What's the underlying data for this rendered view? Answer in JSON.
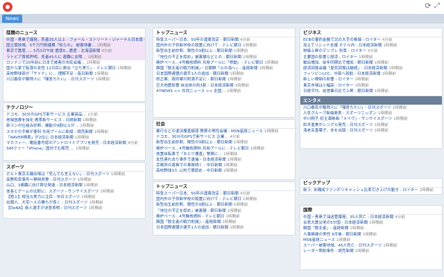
{
  "header": {
    "logo": "app-logo",
    "tab_label": "News",
    "icons": [
      "refresh-icon",
      "expand-icon"
    ]
  },
  "panels": [
    {
      "id": "p1",
      "title": "話題のニュース",
      "highlight": [
        0,
        1,
        2,
        3
      ],
      "items": [
        {
          "text": "中国・青島で爆発。死者35人以上 - フォール・ストリート・ジャーナル日本版",
          "time": "4分前"
        },
        {
          "text": "国立競技場、5千万円修繕費「知られ」 被害地審…",
          "time": "1時間前"
        },
        {
          "text": "東京で震度…。5月3日午前 震度6…震度 - 北海道新聞",
          "time": "4分前"
        },
        {
          "text": "ラトビア首相声明、死者45人に 避難に支障…",
          "time": "1時間前"
        },
        {
          "text": "ロンドンで20年前に日本で被害の市民会議…",
          "time": "1時間前"
        },
        {
          "text": "国から家で転落の女性 12日目に救出「立ち寄り」- テレビ朝日",
          "time": "1時間前"
        },
        {
          "text": "高校野球部が「サイド」に… 理解不足 - 毎日新聞",
          "time": "1時間前"
        },
        {
          "text": "川口春奈が駆除人に「嘆答ちたい」- 日刊スポーツ",
          "time": "1時間前"
        }
      ]
    },
    {
      "id": "p2",
      "title": "テクノロジー",
      "items": [
        {
          "text": "ドコモ、30分のGPSで新サービス 企業商品…",
          "time": "1分前"
        },
        {
          "text": "地域医療を強化 携帯新サービス - 日経新聞",
          "time": "1時間前"
        },
        {
          "text": "新ランの仕組み診断、機能の9割以上が…",
          "time": "1時間前"
        },
        {
          "text": "スマホの手帳が便利 共用プールに新設 - 読売新聞",
          "time": "1時間前"
        },
        {
          "text": "「NAVER検索」が2位に 日本経済新聞",
          "time": "1時間前"
        },
        {
          "text": "マカフィー、電話番号認のアンドロイドアプリを発売 - 日本経済新聞",
          "time": "4分前"
        },
        {
          "text": "SIMフリー「iPhone」国内でも販売 …",
          "time": "1時間前"
        }
      ]
    },
    {
      "id": "p3",
      "title": "スポーツ",
      "items": [
        {
          "text": "ボルト東京五輪出場は「死んでも言えない」- 日刊スポーツ",
          "time": "1時間前"
        },
        {
          "text": "高野和幸事件＝静岡県警 - 日刊スポーツ",
          "time": "1時間前"
        },
        {
          "text": "山口、3連覇に向け首位発進 - 日本経済新聞",
          "time": "1時間前"
        },
        {
          "text": "信長とゲームの比較に、スポーツ - サンケイスポーツ",
          "time": "1時間前"
        },
        {
          "text": "【陸上】相当な実力に注目 - 中日スポーツ",
          "time": "1時間前"
        },
        {
          "text": "出頭人、大宅一人の勝ちが良く - 日刊スポーツ",
          "time": "1時間前"
        },
        {
          "text": "【DeNA】新人選手が決意表明 - 日刊スポーツ",
          "time": "1時間前"
        }
      ]
    },
    {
      "id": "p4",
      "title": "トップニュース",
      "items": [
        {
          "text": "特急スーパー日本、50年の運賃改定 - 朝日新聞",
          "time": "4分前"
        },
        {
          "text": "国内外の子供新学校の設置に向けて - テレビ朝日",
          "time": "1時間前"
        },
        {
          "text": "新型出生前診断、陽性の9割以上 - 朝日新聞",
          "time": "1時間前"
        },
        {
          "text": "「地位の不正を認め」被害額などとの - 朝日新聞",
          "time": "1時間前"
        },
        {
          "text": "廃炉ペース…4号機核燃料 共用プールに「移動」- テレビ朝日",
          "time": "1時間前"
        },
        {
          "text": "韓国「脱北者の戦力削減」・北朝鮮「火の海へ」- 産経新聞",
          "time": "1時間前"
        },
        {
          "text": "日本国際連盟の選手1人の追加 - 朝日新聞",
          "time": "1時間前"
        },
        {
          "text": "修正案、政府案の財源不足に - 朝日新聞",
          "time": "1時間前"
        },
        {
          "text": "巨大地震影響 自治体の約3割 - 日本経済新聞",
          "time": "1時間前"
        },
        {
          "text": "47NEWS >> 共同ニュース >> 全国…",
          "time": "1時間前"
        }
      ]
    },
    {
      "id": "p5",
      "title": "社会",
      "items": [
        {
          "text": "暴行などの違法捜査疑惑 警察の男性会議 - MSN産経ニュース",
          "time": "1時間前"
        },
        {
          "text": "ドコモ、30分のGPSで新サービス 企業…",
          "time": "4分前"
        },
        {
          "text": "新型出生前診断、陽性の9割以上 - 朝日新聞",
          "time": "1時間前"
        },
        {
          "text": "廃炉ペース…4号機核燃料 共用プールに - テレビ朝日",
          "time": "1時間前"
        },
        {
          "text": "放置自転車で「おとり捜査」警察に…",
          "time": "1時間前"
        },
        {
          "text": "女性連れ去り事件で逮捕 - 日本経済新聞",
          "time": "1時間前"
        },
        {
          "text": "京都府の遊具での事故続く - 中日新聞",
          "time": "1時間前"
        },
        {
          "text": "高校野球3人 公判で罪認め - 中日新聞",
          "time": "1時間前"
        }
      ]
    },
    {
      "id": "p6",
      "title": "トップニュース",
      "items": [
        {
          "text": "特急スーパー日本、50年の運賃改定 - 朝日新聞",
          "time": "4分前"
        },
        {
          "text": "国内外の子供新学校の設置に向けて - テレビ朝日",
          "time": "1時間前"
        },
        {
          "text": "新型出生前診断、陽性の9割以上 - 朝日新聞",
          "time": "1時間前"
        },
        {
          "text": "「地位の不正を認め」被害額 - 朝日新聞",
          "time": "1時間前"
        },
        {
          "text": "廃炉ペース…4号機核燃料 - テレビ朝日",
          "time": "1時間前"
        },
        {
          "text": "韓国「脱北者の戦力削減」- 産経新聞",
          "time": "1時間前"
        },
        {
          "text": "日本国際連盟の選手1人の追加 - 朝日新聞",
          "time": "1時間前"
        }
      ]
    },
    {
      "id": "p7",
      "title": "ビジネス",
      "items": [
        {
          "text": "ECBの量的金融で北の大手の株価 - ロイター",
          "time": "4分前"
        },
        {
          "text": "加えてリシッド支援 ホテル内 - 日本経済新聞",
          "time": "1時間前"
        },
        {
          "text": "物価上昇のデンプレ 利率 - ロイター",
          "time": "4分前"
        },
        {
          "text": "主要国の影響と経済 - ロイター",
          "time": "1時間前"
        },
        {
          "text": "輸出増加、前年同期比で増加 - 朝日新聞",
          "time": "1時間前"
        },
        {
          "text": "経済回復会議「景気回復は継続」- 日本経済新聞",
          "time": "1時間前"
        },
        {
          "text": "フィリピンLCC、中部へ就航 - 日本経済新聞",
          "time": "1時間前"
        },
        {
          "text": "新しい規制の影響 - ロイター",
          "time": "1時間前"
        },
        {
          "text": "東京市場は小幅高 - ロイター",
          "time": "1時間前"
        },
        {
          "text": "日経平均、前営業日比で上昇 - 朝日新聞",
          "time": "1時間前"
        },
        {
          "text": "「ユーロ」、米国との金融政策 - 日本経済新聞",
          "time": "1時間前"
        },
        {
          "text": "経済成長率、今期の予測を修正 - ロイター",
          "time": "1時間前"
        }
      ]
    },
    {
      "id": "p8",
      "title": "エンタメ",
      "dark": true,
      "items": [
        {
          "text": "川口春奈が駆除人に「嘆答ちたい」- 日刊スポーツ",
          "time": "1時間前"
        },
        {
          "text": "人気グループ新曲発表 - スポーツニッポン",
          "time": "1時間前"
        },
        {
          "text": "中川翔子 初主演映画「メイヴ」- サンケイスポーツ",
          "time": "1時間前"
        },
        {
          "text": "鈴木亜美がシングル発売 - 日刊スポーツ",
          "time": "1時間前"
        },
        {
          "text": "海老名香葉子、本を出版 - 日刊スポーツ",
          "time": "1時間前"
        }
      ]
    },
    {
      "id": "p9",
      "title": "ピックアップ",
      "items": [
        {
          "text": "新ラ; 米構成ファンがリキャッシュ比率引き上げの動き - ロイター",
          "time": "2時間前"
        },
        {
          "text": "現代を描く中から食費 1日の負担 - 北日本新聞",
          "time": "1時間前"
        }
      ]
    },
    {
      "id": "p10",
      "title": "国際",
      "items": [
        {
          "text": "中国・青島で油送管爆発、35人死亡 - 日本経済新聞",
          "time": "4分前"
        },
        {
          "text": "合意大震災他の5か国 - 日本経済新聞",
          "time": "1時間前"
        },
        {
          "text": "韓国「脱北者」- 産経新聞",
          "time": "1時間前"
        },
        {
          "text": "人事関連の男性 9月後 - 朝日新聞",
          "time": "1時間前"
        },
        {
          "text": "MSN産経ニュース",
          "time": "1時間前"
        },
        {
          "text": "スーパー被害地域、45人死亡 - 日刊スポーツ",
          "time": "1時間前"
        },
        {
          "text": "レーダー照射事件 - 読売新聞",
          "time": "1時間前"
        }
      ]
    }
  ]
}
